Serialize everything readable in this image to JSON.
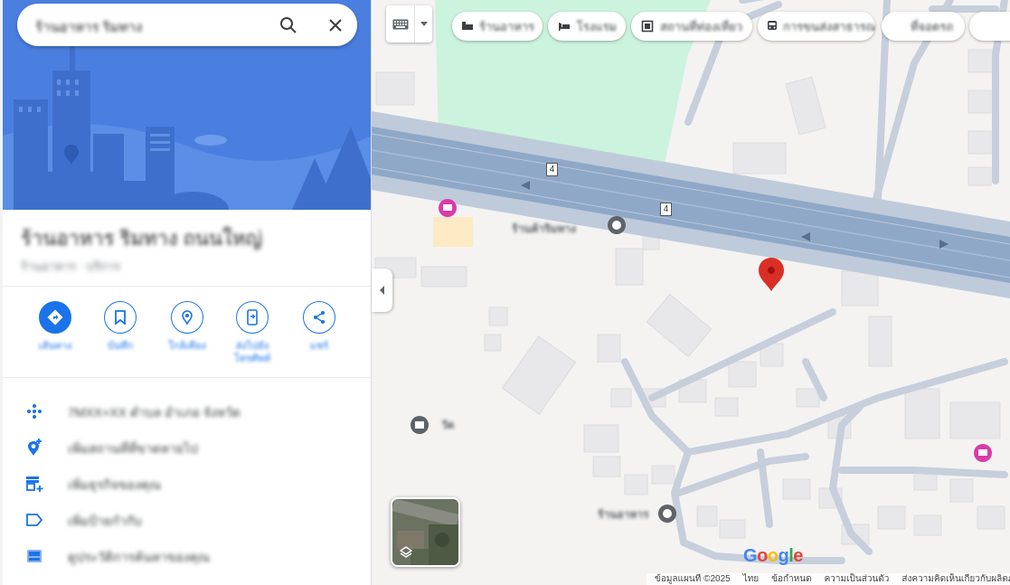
{
  "search": {
    "query": "ร้านอาหาร ริมทาง",
    "search_icon": "search-icon",
    "close_icon": "close-icon"
  },
  "place": {
    "title": "ร้านอาหาร ริมทาง ถนนใหญ่",
    "subtitle": "ร้านอาหาร · บริการ"
  },
  "actions": [
    {
      "label": "เส้นทาง",
      "icon": "directions-icon"
    },
    {
      "label": "บันทึก",
      "icon": "bookmark-icon"
    },
    {
      "label": "ใกล้เคียง",
      "icon": "nearby-icon"
    },
    {
      "label": "ส่งไปยัง โทรศัพท์",
      "icon": "send-to-phone-icon"
    },
    {
      "label": "แชร์",
      "icon": "share-icon"
    }
  ],
  "info_rows": [
    {
      "text": "7MXX+XX ตำบล อำเภอ จังหวัด",
      "icon": "plus-code-icon"
    },
    {
      "text": "เพิ่มสถานที่ที่ขาดหายไป",
      "icon": "add-place-icon"
    },
    {
      "text": "เพิ่มธุรกิจของคุณ",
      "icon": "add-business-icon"
    },
    {
      "text": "เพิ่มป้ายกำกับ",
      "icon": "label-icon"
    },
    {
      "text": "ดูประวัติการค้นหาของคุณ",
      "icon": "history-icon"
    }
  ],
  "chips": [
    {
      "label": "ร้านอาหาร",
      "icon": "restaurant-icon"
    },
    {
      "label": "โรงแรม",
      "icon": "hotel-icon"
    },
    {
      "label": "สถานที่ท่องเที่ยว",
      "icon": "attraction-icon"
    },
    {
      "label": "การขนส่งสาธารณะ",
      "icon": "transit-icon"
    },
    {
      "label": "ที่จอดรถ",
      "icon": "parking-icon"
    }
  ],
  "map": {
    "route_number": "4",
    "poi_1": "ร้านค้าริมทาง",
    "poi_2": "ร้านอาหาร",
    "poi_3": "วัด",
    "marker_color": "#d93025",
    "pink_poi_color": "#d93ca9"
  },
  "google_logo": "Google",
  "footer": {
    "map_data": "ข้อมูลแผนที่ ©2025",
    "language": "ไทย",
    "terms": "ข้อกำหนด",
    "privacy": "ความเป็นส่วนตัว",
    "feedback": "ส่งความคิดเห็นเกี่ยวกับผลิตภัณฑ์"
  },
  "colors": {
    "accent": "#1a73e8",
    "hero_bg": "#4a7fe0",
    "highway": "#8fa8c8",
    "park": "#ccf3de"
  }
}
